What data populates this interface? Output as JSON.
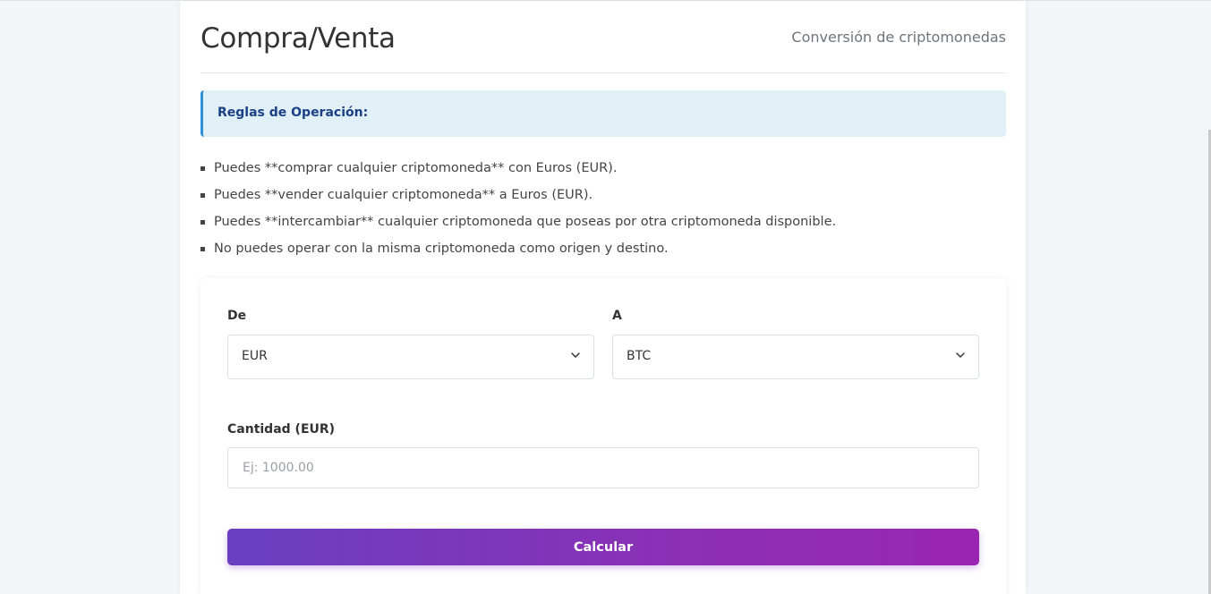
{
  "header": {
    "title": "Compra/Venta",
    "subtitle": "Conversión de criptomonedas"
  },
  "rules": {
    "title": "Reglas de Operación:",
    "items": [
      "Puedes **comprar cualquier criptomoneda** con Euros (EUR).",
      "Puedes **vender cualquier criptomoneda** a Euros (EUR).",
      "Puedes **intercambiar** cualquier criptomoneda que poseas por otra criptomoneda disponible.",
      "No puedes operar con la misma criptomoneda como origen y destino."
    ]
  },
  "form": {
    "from_label": "De",
    "from_value": "EUR",
    "to_label": "A",
    "to_value": "BTC",
    "amount_label": "Cantidad (EUR)",
    "amount_placeholder": "Ej: 1000.00",
    "amount_value": "",
    "submit_label": "Calcular"
  },
  "colors": {
    "accent_gradient_start": "#6a3fc2",
    "accent_gradient_end": "#9a25b0",
    "info_bg": "#e1f0f7",
    "info_border": "#2f8fd8",
    "info_title": "#1b3f86"
  },
  "icons": {
    "select_chevron": "chevron-down-icon"
  }
}
